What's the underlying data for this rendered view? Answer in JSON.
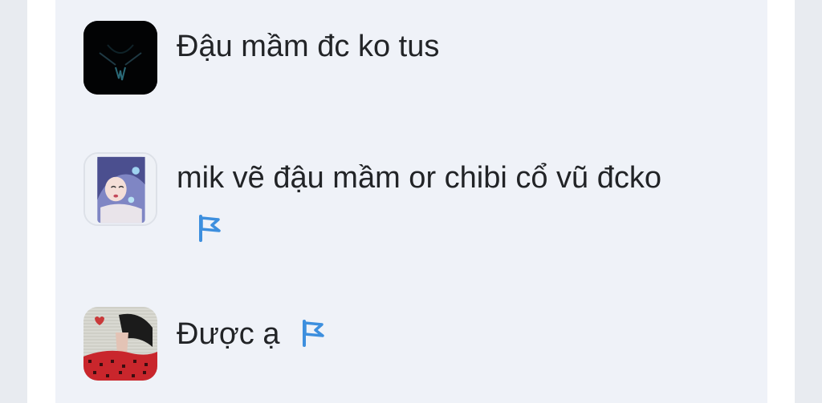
{
  "comments": [
    {
      "text": "Đậu mầm đc ko tus",
      "flag": false,
      "avatar_icon": "dark-creature-avatar"
    },
    {
      "text": "mik vẽ đậu mầm or chibi cổ vũ đcko",
      "flag": true,
      "avatar_icon": "anime-girl-avatar"
    },
    {
      "text": "Được ạ",
      "flag": true,
      "avatar_icon": "red-plaid-avatar"
    }
  ],
  "colors": {
    "panel_bg": "#eff2f8",
    "text": "#222427",
    "flag": "#3d8fde"
  }
}
